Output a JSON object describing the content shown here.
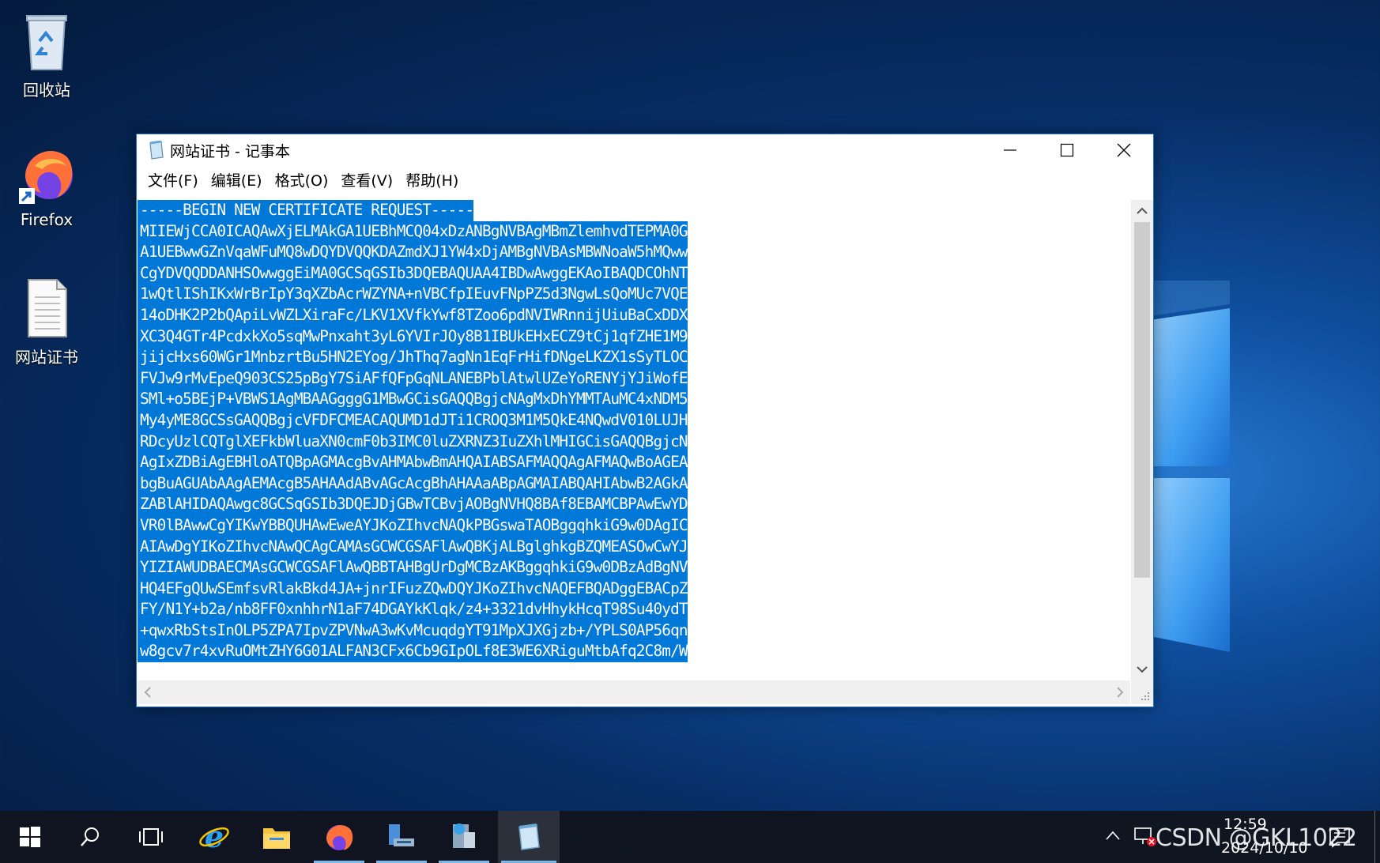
{
  "desktop": {
    "icons": [
      {
        "label": "回收站"
      },
      {
        "label": "Firefox"
      },
      {
        "label": "网站证书"
      }
    ]
  },
  "window": {
    "title": "网站证书 - 记事本",
    "menu": [
      "文件(F)",
      "编辑(E)",
      "格式(O)",
      "查看(V)",
      "帮助(H)"
    ],
    "lines": [
      "-----BEGIN NEW CERTIFICATE REQUEST-----",
      "MIIEWjCCA0ICAQAwXjELMAkGA1UEBhMCQ04xDzANBgNVBAgMBmZlemhvdTEPMA0G",
      "A1UEBwwGZnVqaWFuMQ8wDQYDVQQKDAZmdXJ1YW4xDjAMBgNVBAsMBWNoaW5hMQww",
      "CgYDVQQDDANHSOwwggEiMA0GCSqGSIb3DQEBAQUAA4IBDwAwggEKAoIBAQDCOhNT",
      "1wQtlIShIKxWrBrIpY3qXZbAcrWZYNA+nVBCfpIEuvFNpPZ5d3NgwLsQoMUc7VQE",
      "14oDHK2P2bQApiLvWZLXiraFc/LKV1XVfkYwf8TZoo6pdNVIWRnnijUiuBaCxDDX",
      "XC3Q4GTr4PcdxkXo5sqMwPnxaht3yL6YVIrJOy8B1IBUkEHxECZ9tCj1qfZHE1M9",
      "jijcHxs60WGr1MnbzrtBu5HN2EYog/JhThq7agNn1EqFrHifDNgeLKZX1sSyTLOC",
      "FVJw9rMvEpeQ903CS25pBgY7SiAFfQFpGqNLANEBPblAtwlUZeYoRENYjYJiWofE",
      "SMl+o5BEjP+VBWS1AgMBAAGgggG1MBwGCisGAQQBgjcNAgMxDhYMMTAuMC4xNDM5",
      "My4yME8GCSsGAQQBgjcVFDFCMEACAQUMD1dJTi1CROQ3M1M5QkE4NQwdV010LUJH",
      "RDcyUzlCQTglXEFkbWluaXN0cmF0b3IMC0luZXRNZ3IuZXhlMHIGCisGAQQBgjcN",
      "AgIxZDBiAgEBHloATQBpAGMAcgBvAHMAbwBmAHQAIABSAFMAQQAgAFMAQwBoAGEA",
      "bgBuAGUAbAAgAEMAcgB5AHAAdABvAGcAcgBhAHAAaABpAGMAIABQAHIAbwB2AGkA",
      "ZABlAHIDAQAwgc8GCSqGSIb3DQEJDjGBwTCBvjAOBgNVHQ8BAf8EBAMCBPAwEwYD",
      "VR0lBAwwCgYIKwYBBQUHAwEweAYJKoZIhvcNAQkPBGswaTAOBggqhkiG9w0DAgIC",
      "AIAwDgYIKoZIhvcNAwQCAgCAMAsGCWCGSAFlAwQBKjALBglghkgBZQMEASOwCwYJ",
      "YIZIAWUDBAECMAsGCWCGSAFlAwQBBTAHBgUrDgMCBzAKBggqhkiG9w0DBzAdBgNV",
      "HQ4EFgQUwSEmfsvRlakBkd4JA+jnrIFuzZQwDQYJKoZIhvcNAQEFBQADggEBACpZ",
      "FY/N1Y+b2a/nb8FF0xnhhrN1aF74DGAYkKlqk/z4+3321dvHhykHcqT98Su40ydT",
      "+qwxRbStsInOLP5ZPA7IpvZPVNwA3wKvMcuqdgYT91MpXJXGjzb+/YPLS0AP56qn",
      "w8gcv7r4xvRuOMtZHY6G01ALFAN3CFx6Cb9GIpOLf8E3WE6XRiguMtbAfq2C8m/W"
    ]
  },
  "taskbar": {
    "clock_time": "12:59",
    "clock_date": "2024/10/10",
    "watermark": "CSDN @GKL1022"
  },
  "colors": {
    "selection": "#0078d7",
    "window_border": "#1a73c7"
  }
}
